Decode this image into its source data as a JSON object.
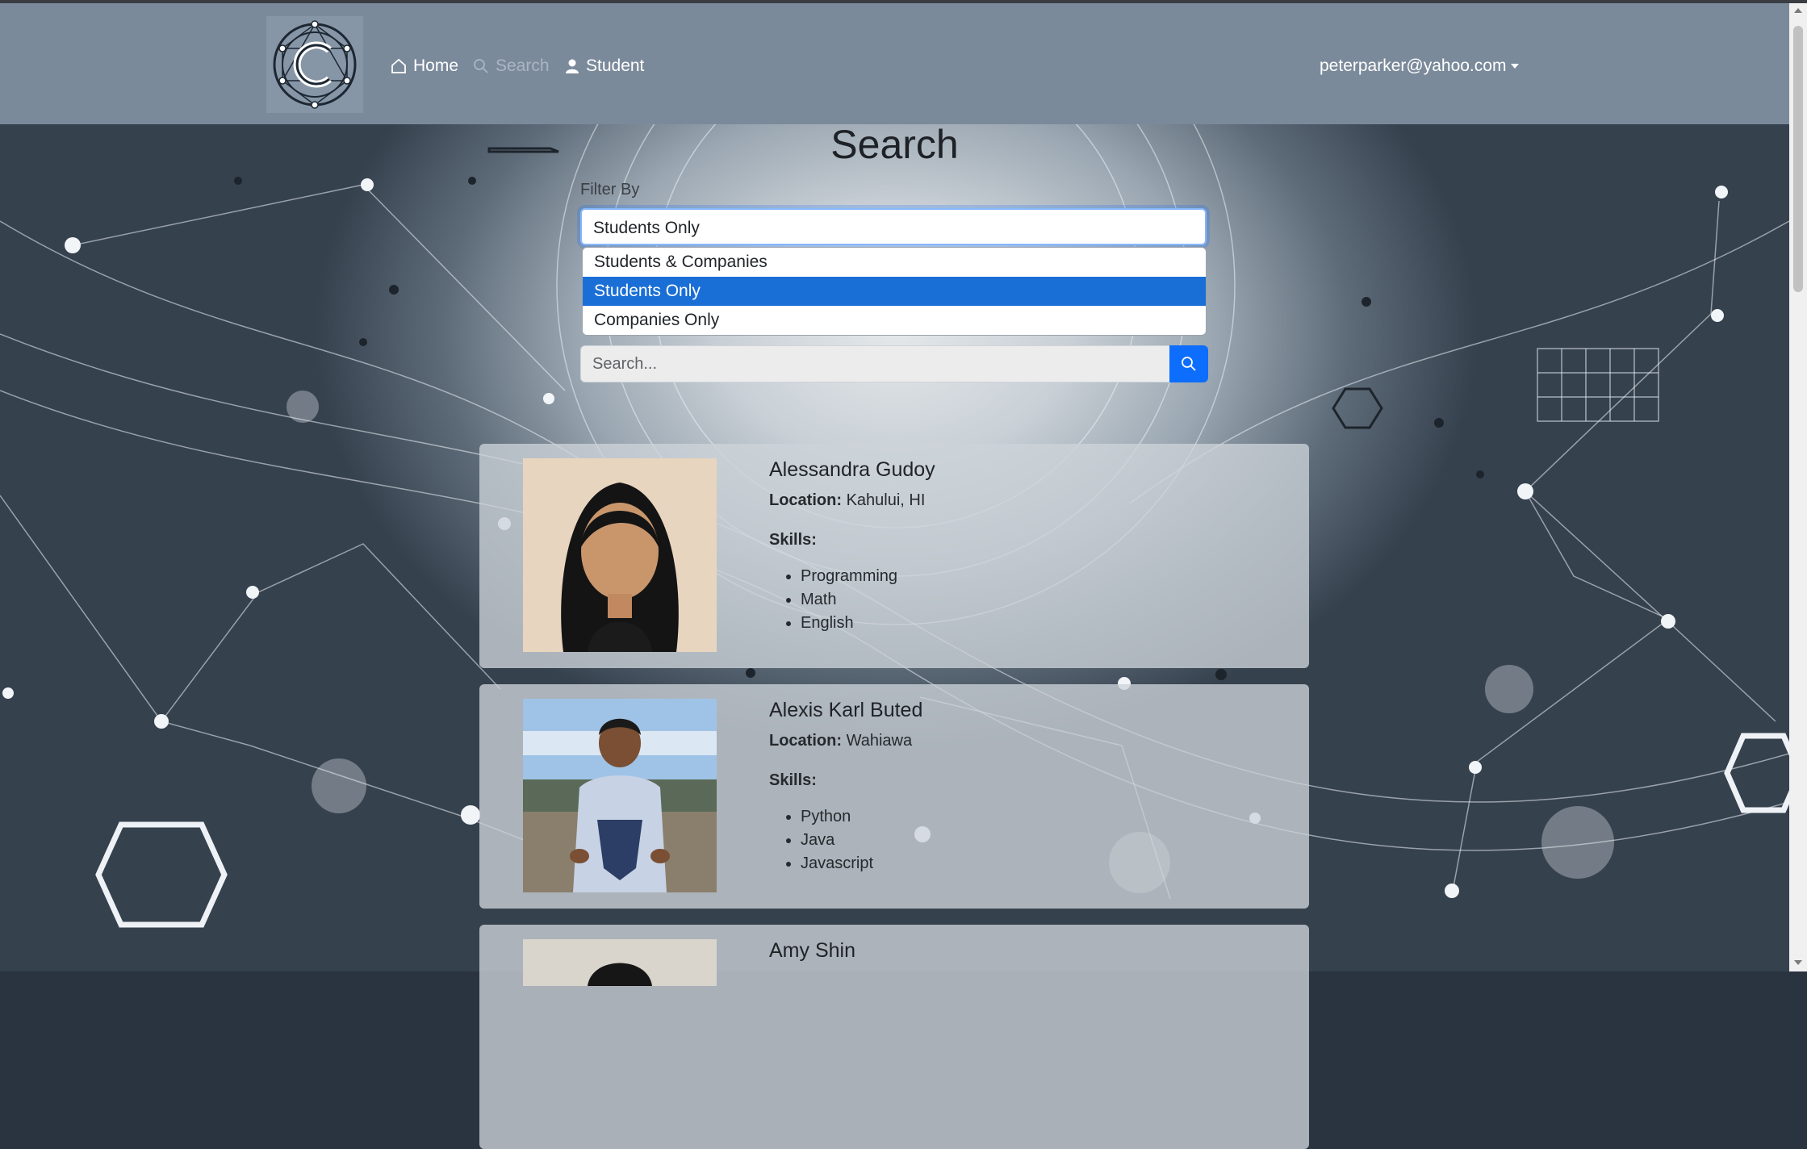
{
  "nav": {
    "logo_icon": "circuit-c-logo",
    "home_label": "Home",
    "search_label": "Search",
    "student_label": "Student",
    "user_email": "peterparker@yahoo.com"
  },
  "page": {
    "title": "Search",
    "filter_label": "Filter By",
    "filter_selected": "Students Only",
    "filter_options": [
      "Students & Companies",
      "Students Only",
      "Companies Only"
    ],
    "search_placeholder": "Search..."
  },
  "results": [
    {
      "name": "Alessandra Gudoy",
      "location_label": "Location:",
      "location": "Kahului, HI",
      "skills_label": "Skills:",
      "skills": [
        "Programming",
        "Math",
        "English"
      ]
    },
    {
      "name": "Alexis Karl Buted",
      "location_label": "Location:",
      "location": "Wahiawa",
      "skills_label": "Skills:",
      "skills": [
        "Python",
        "Java",
        "Javascript"
      ]
    },
    {
      "name": "Amy Shin"
    }
  ],
  "colors": {
    "navbar": "#7b8a9b",
    "accent": "#0d6efd",
    "selected_option": "#1a6fd6"
  }
}
